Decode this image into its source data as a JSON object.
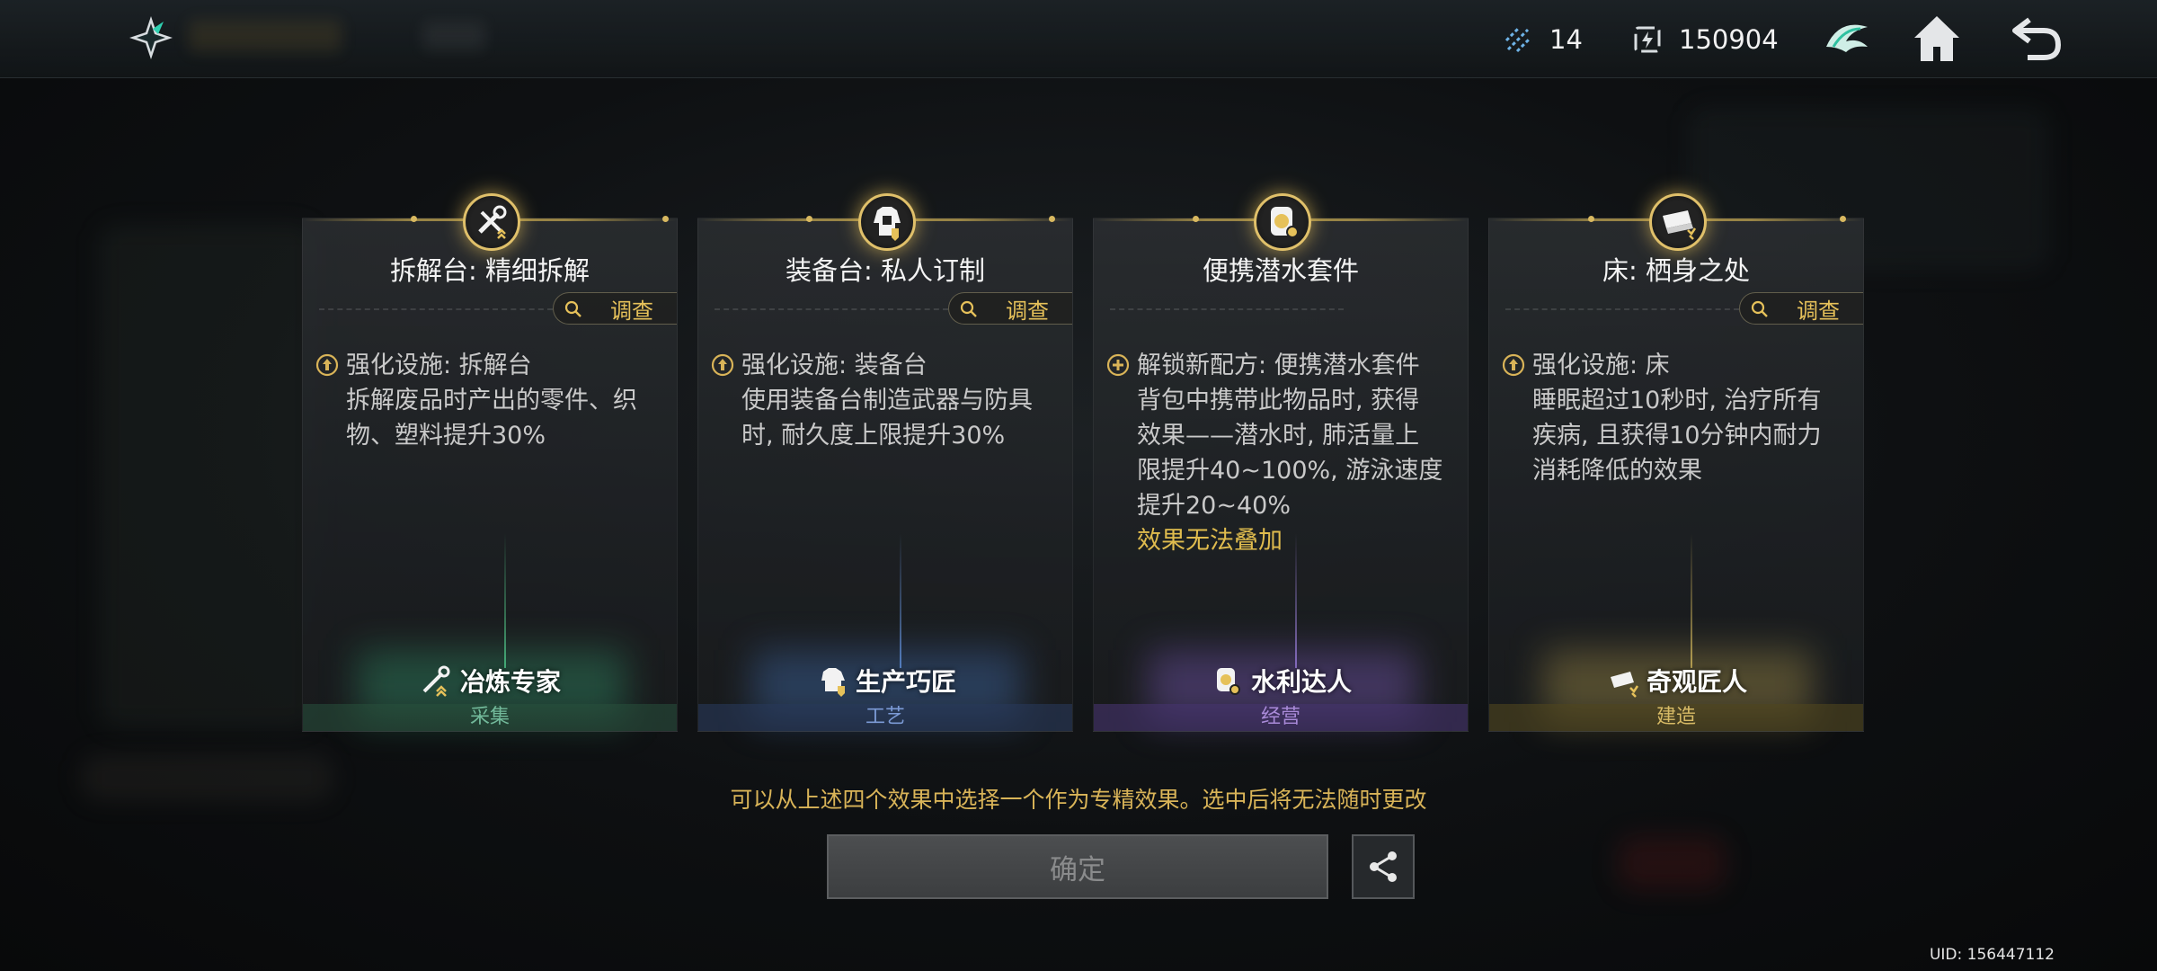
{
  "topbar": {
    "resources": [
      {
        "icon": "crystal-icon",
        "value": "14"
      },
      {
        "icon": "energy-icon",
        "value": "150904"
      }
    ],
    "buttons": [
      "ship-emblem-icon",
      "home-icon",
      "back-icon"
    ]
  },
  "cards": [
    {
      "title": "拆解台: 精细拆解",
      "investigate": "调查",
      "desc_icon": "upgrade-icon",
      "lines": [
        "强化设施: 拆解台",
        "拆解废品时产出的零件、织",
        "物、塑料提升30%"
      ],
      "highlight": "",
      "role": "冶炼专家",
      "category": "采集",
      "badge_icon": "wrench-hammer-icon"
    },
    {
      "title": "装备台: 私人订制",
      "investigate": "调查",
      "desc_icon": "upgrade-icon",
      "lines": [
        "强化设施: 装备台",
        "使用装备台制造武器与防具",
        "时, 耐久度上限提升30%"
      ],
      "highlight": "",
      "role": "生产巧匠",
      "category": "工艺",
      "badge_icon": "armor-icon"
    },
    {
      "title": "便携潜水套件",
      "investigate": "",
      "desc_icon": "unlock-plus-icon",
      "lines": [
        "解锁新配方: 便携潜水套件",
        "背包中携带此物品时, 获得",
        "效果——潜水时, 肺活量上",
        "限提升40~100%, 游泳速度",
        "提升20~40%"
      ],
      "highlight": "效果无法叠加",
      "role": "水利达人",
      "category": "经营",
      "badge_icon": "diving-kit-icon"
    },
    {
      "title": "床: 栖身之处",
      "investigate": "调查",
      "desc_icon": "upgrade-icon",
      "lines": [
        "强化设施: 床",
        "睡眠超过10秒时, 治疗所有",
        "疾病, 且获得10分钟内耐力",
        "消耗降低的效果"
      ],
      "highlight": "",
      "role": "奇观匠人",
      "category": "建造",
      "badge_icon": "bed-icon"
    }
  ],
  "hint": "可以从上述四个效果中选择一个作为专精效果。选中后将无法随时更改",
  "confirm_label": "确定",
  "uid": "UID: 156447112",
  "colors": {
    "accent_gold": "#e0bc4e",
    "gather_green": "#72b99a",
    "craft_blue": "#7c9bd6",
    "manage_purple": "#a98ad8",
    "build_gold": "#d8bb66"
  }
}
